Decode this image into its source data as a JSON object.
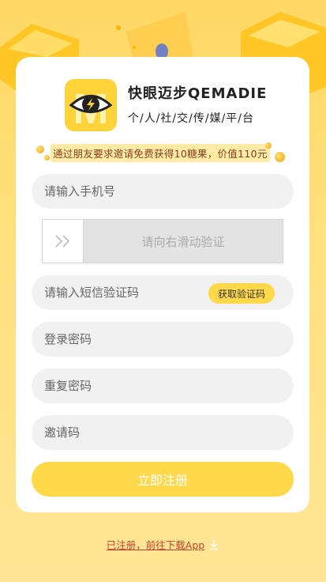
{
  "brand": {
    "title": "快眼迈步QEMADIE",
    "subtitle": "个/人/社/交/传/媒/平/台",
    "logo_letter": "M"
  },
  "promo": {
    "text": "通过朋友要求邀请免费获得10糖果，价值110元"
  },
  "form": {
    "phone_placeholder": "请输入手机号",
    "slider_text": "请向右滑动验证",
    "sms_code_placeholder": "请输入短信验证码",
    "sms_button_label": "获取验证码",
    "password_placeholder": "登录密码",
    "repeat_password_placeholder": "重复密码",
    "invite_code_placeholder": "邀请码",
    "submit_label": "立即注册"
  },
  "footer": {
    "download_link": "已注册，前往下载App"
  },
  "colors": {
    "accent": "#ffd94a",
    "background": "#ffd865",
    "link": "#c2432b"
  }
}
